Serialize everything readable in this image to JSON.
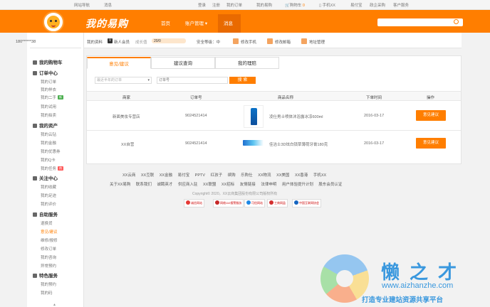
{
  "topbar": {
    "nav": "网站导航",
    "greeting": "消息",
    "login": "登录",
    "register": "注册",
    "my_orders": "我的订单",
    "my_account": "我的易购",
    "cart": "购物车",
    "cart_count": "0",
    "mobile": "手机XX",
    "pay": "易付宝",
    "enterprise": "政企采购",
    "service": "客户服务"
  },
  "header": {
    "logo_text": "我的易购",
    "nav": [
      "首页",
      "账户管理",
      "消息"
    ],
    "search_placeholder": ""
  },
  "sidebar": {
    "username": "180******38",
    "sections": [
      {
        "title": "我的购物车",
        "items": []
      },
      {
        "title": "订单中心",
        "items": [
          "我的订单",
          "我的样衣",
          "我的二手",
          "我的试用",
          "我的拍卖"
        ]
      },
      {
        "title": "我的资产",
        "items": [
          "我的云钻",
          "我的金融",
          "我的优惠券",
          "我的Q卡",
          "我的任务"
        ]
      },
      {
        "title": "关注中心",
        "items": [
          "我的收藏",
          "我的足迹",
          "我的评价"
        ]
      },
      {
        "title": "自助服务",
        "items": [
          "退换货",
          "意见/建议",
          "维修/报修",
          "修改订单",
          "我的咨询",
          "异常预约"
        ]
      },
      {
        "title": "特色服务",
        "items": [
          "我的预约",
          "我的码"
        ]
      }
    ],
    "tags": {
      "new": "新",
      "hot": "热"
    }
  },
  "infobar": {
    "profile": "我的资料",
    "member": "新人会员",
    "growth_label": "成长值",
    "growth_value": "20/0",
    "security": "安全等级：中",
    "edit_phone": "修改手机",
    "edit_email": "修改邮箱",
    "address": "地址管理"
  },
  "tabs": [
    "意见/建议",
    "建议查询",
    "我的理赔"
  ],
  "filter": {
    "select_placeholder": "最近半年的订单",
    "input_placeholder": "订单号",
    "search_btn": "搜 索"
  },
  "table": {
    "headers": [
      "商家",
      "订单号",
      "商品名称",
      "下单时间",
      "操作"
    ],
    "rows": [
      {
        "store": "新面美妆专营店",
        "order": "9024521414",
        "product": "凌仕男士喷体沐浴露冰凉600ml",
        "date": "2016-03-17",
        "action": "意见建议"
      },
      {
        "store": "XX自营",
        "order": "9024521414",
        "product": "佳洁士3D炫白锁草薄荷牙膏180克",
        "date": "2016-03-17",
        "action": "意见建议"
      }
    ]
  },
  "footer": {
    "links1": [
      "XX云商",
      "XX互联",
      "XX金融",
      "易付宝",
      "PPTV",
      "红孩子",
      "缤购",
      "乐购仕",
      "XX物流",
      "XX美国",
      "XX香港",
      "手机XX"
    ],
    "links2": [
      "关于XX易购",
      "联系我们",
      "诚聘英才",
      "供应商入驻",
      "XX联盟",
      "XX招标",
      "友情链接",
      "法律申明",
      "用户体验提升计划",
      "股东会员认证"
    ],
    "copyright": "Copyright© 2020，XX云商集团股份有限公司版权所有",
    "badges": [
      "诚信网站",
      "网络110报警服务",
      "可信网站",
      "工商网监",
      "经营性网站",
      "中国互联网协会"
    ]
  },
  "watermark": {
    "title": "懒之才",
    "url": "www.aizhanzhe.com",
    "slogan": "打造专业建站资源共享平台"
  },
  "colors": {
    "brand": "#ff7e00",
    "watermark": "#3a98de"
  }
}
